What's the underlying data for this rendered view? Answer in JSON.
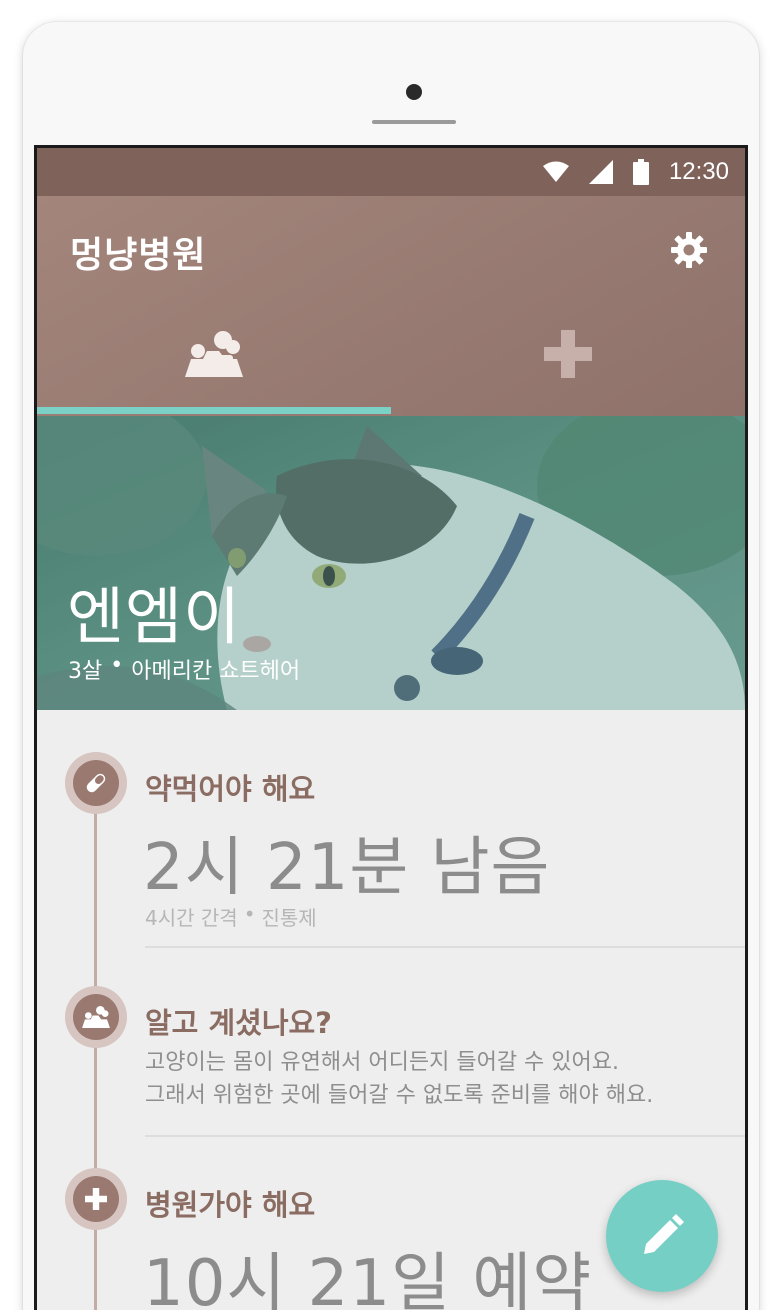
{
  "status_bar": {
    "time": "12:30"
  },
  "app_bar": {
    "title": "멍냥병원"
  },
  "tabs": [
    {
      "id": "pets",
      "icon": "pets-icon",
      "selected": true
    },
    {
      "id": "hospital",
      "icon": "plus-icon",
      "selected": false
    }
  ],
  "pet": {
    "name": "엔엠이",
    "age": "3살",
    "separator": "•",
    "breed": "아메리칸 쇼트헤어"
  },
  "timeline": [
    {
      "icon": "pill-icon",
      "title": "약먹어야 해요",
      "headline": "2시 21분 남음",
      "sub_interval": "4시간 간격",
      "separator": "•",
      "sub_medicine": "진통제"
    },
    {
      "icon": "pets-icon",
      "title": "알고 계셨나요?",
      "line1": "고양이는 몸이 유연해서 어디든지 들어갈 수 있어요.",
      "line2": "그래서 위험한 곳에 들어갈 수 없도록 준비를 해야 해요."
    },
    {
      "icon": "plus-icon",
      "title": "병원가야 해요",
      "headline": "10시 21일 예약"
    }
  ],
  "colors": {
    "status_bar": "#7f635b",
    "app_bar": "#977a71",
    "accent": "#76cfc5",
    "timeline_title": "#8a6c62"
  },
  "fab": {
    "icon": "pencil-icon"
  }
}
